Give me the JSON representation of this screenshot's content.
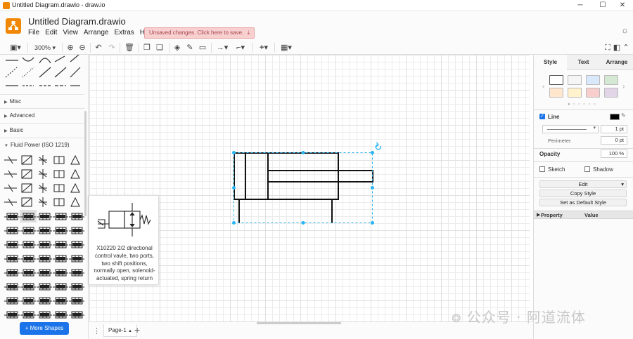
{
  "window": {
    "title": "Untitled Diagram.drawio - draw.io",
    "controls": [
      "─",
      "☐",
      "✕"
    ]
  },
  "header": {
    "doc_title": "Untitled Diagram.drawio",
    "menu": [
      "File",
      "Edit",
      "View",
      "Arrange",
      "Extras",
      "Help"
    ],
    "unsaved_label": "Unsaved changes. Click here to save."
  },
  "toolbar": {
    "zoom": "300%"
  },
  "sidebar": {
    "sections": [
      "Misc",
      "Advanced",
      "Basic",
      "Fluid Power (ISO 1219)"
    ],
    "more_shapes_label": "+ More Shapes"
  },
  "tooltip": {
    "text": "X10220 2/2 directional control vavle, two ports, two shift positions, normally open, solenoid-actuated, spring return"
  },
  "panel": {
    "tabs": [
      "Style",
      "Text",
      "Arrange"
    ],
    "swatch_colors": [
      "#ffffff",
      "#f5f5f5",
      "#dae8fc",
      "#d5e8d4",
      "#ffe6cc",
      "#fff2cc",
      "#f8cecc",
      "#e1d5e7"
    ],
    "line_label": "Line",
    "line_width": "1 pt",
    "perimeter_label": "Perimeter",
    "perimeter_value": "0 pt",
    "opacity_label": "Opacity",
    "opacity_value": "100 %",
    "sketch_label": "Sketch",
    "shadow_label": "Shadow",
    "edit_label": "Edit",
    "copy_style_label": "Copy Style",
    "set_default_label": "Set as Default Style",
    "property_header": "Property",
    "value_header": "Value"
  },
  "bottom": {
    "page_tab": "Page-1"
  },
  "watermark": {
    "text": "公众号 · 阿道流体"
  },
  "colors": {
    "accent": "#1a73e8",
    "logo": "#f08705",
    "selection": "#29b6f2",
    "unsaved_bg": "#f8d0d0",
    "unsaved_text": "#a8484d"
  }
}
